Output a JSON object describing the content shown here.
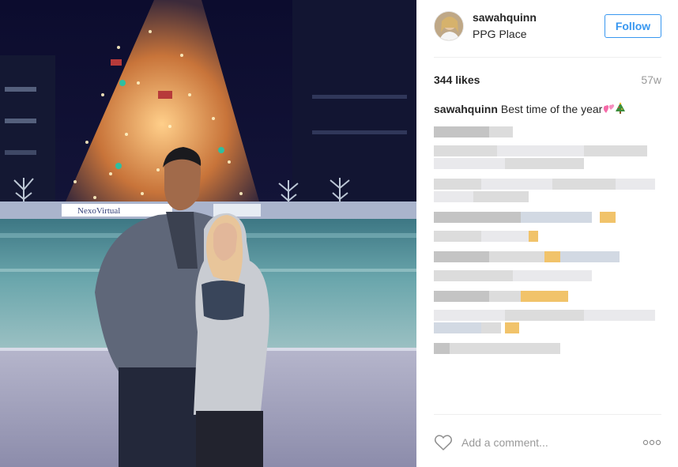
{
  "post": {
    "username": "sawahquinn",
    "location": "PPG Place",
    "follow_label": "Follow",
    "likes": "344 likes",
    "age": "57w",
    "caption": {
      "username": "sawahquinn",
      "text": "Best time of the year",
      "emojis": [
        "pink-hearts-emoji",
        "christmas-tree-emoji"
      ]
    },
    "photo_sign_text": "NexoVirtual",
    "comment_placeholder": "Add a comment..."
  },
  "colors": {
    "accent": "#3897f0",
    "text": "#262626",
    "muted": "#999999",
    "divider": "#efefef"
  },
  "icons": {
    "like": "heart-outline-icon",
    "more": "more-options-icon"
  }
}
